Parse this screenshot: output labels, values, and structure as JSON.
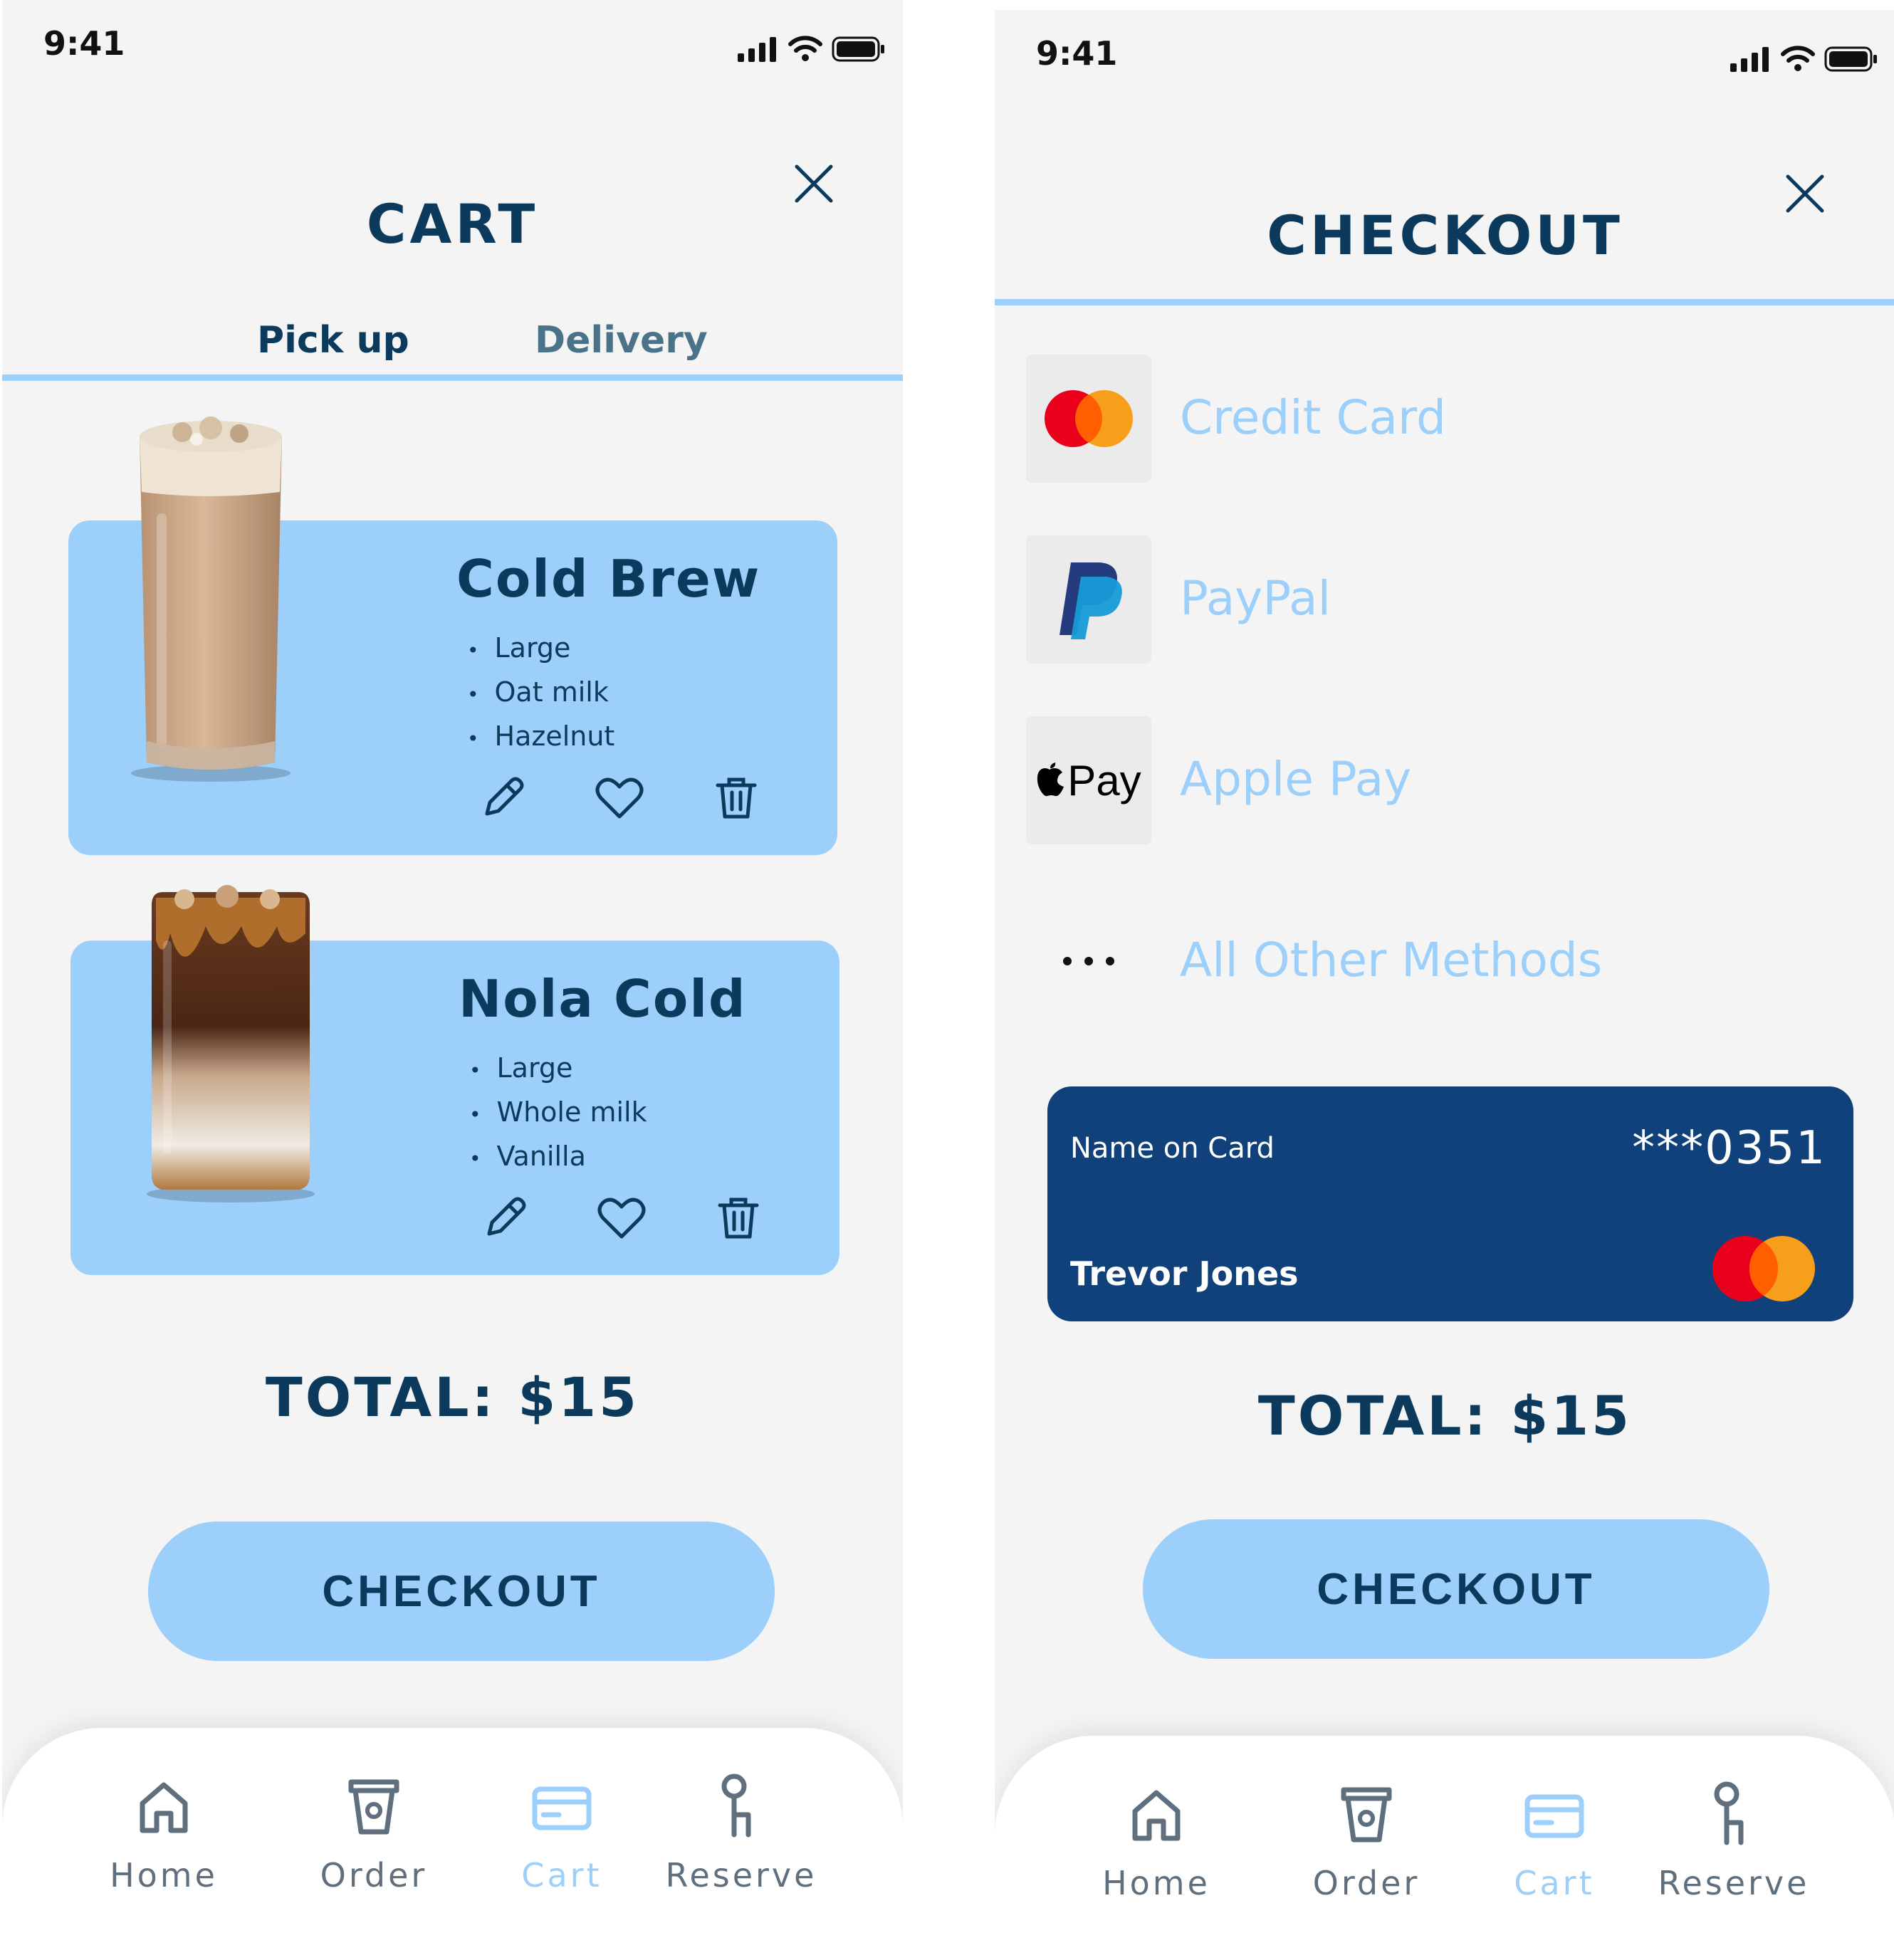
{
  "status_bar": {
    "time": "9:41"
  },
  "cart_screen": {
    "title": "CART",
    "tabs": [
      {
        "label": "Pick up",
        "active": true
      },
      {
        "label": "Delivery",
        "active": false
      }
    ],
    "items": [
      {
        "name": "Cold Brew",
        "options": [
          "Large",
          "Oat milk",
          "Hazelnut"
        ]
      },
      {
        "name": "Nola Cold",
        "options": [
          "Large",
          "Whole milk",
          "Vanilla"
        ]
      }
    ],
    "total": "TOTAL: $15",
    "checkout_label": "CHECKOUT"
  },
  "checkout_screen": {
    "title": "CHECKOUT",
    "apple_pay_logo_text": "Pay",
    "payment_methods": [
      {
        "label": "Credit Card",
        "icon": "mastercard-icon"
      },
      {
        "label": "PayPal",
        "icon": "paypal-icon"
      },
      {
        "label": "Apple Pay",
        "icon": "apple-pay-icon"
      },
      {
        "label": "All Other Methods",
        "icon": "more-icon"
      }
    ],
    "saved_card": {
      "name_label": "Name on Card",
      "number": "***0351",
      "holder": "Trevor Jones"
    },
    "total": "TOTAL: $15",
    "checkout_label": "CHECKOUT"
  },
  "nav": {
    "items": [
      {
        "label": "Home",
        "icon": "home-icon"
      },
      {
        "label": "Order",
        "icon": "cup-icon"
      },
      {
        "label": "Cart",
        "icon": "card-icon",
        "active": true
      },
      {
        "label": "Reserve",
        "icon": "key-icon"
      }
    ]
  },
  "colors": {
    "primary_dark": "#0c3a5c",
    "accent_light": "#9ccffa",
    "card_navy": "#10417a",
    "background": "#f4f4f4"
  }
}
